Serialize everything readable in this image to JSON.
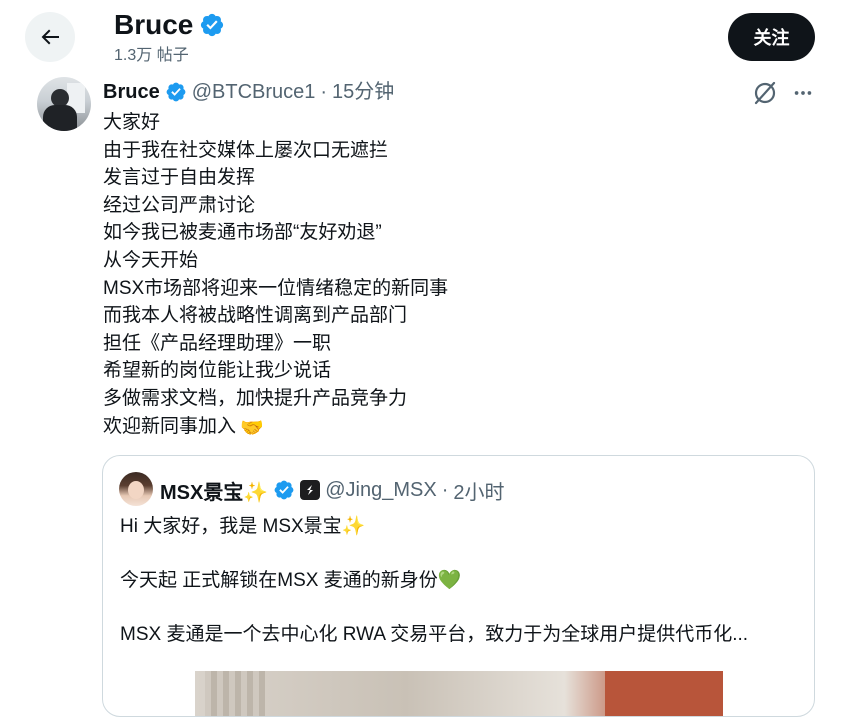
{
  "header": {
    "name": "Bruce",
    "post_count": "1.3万 帖子",
    "follow_label": "关注"
  },
  "tweet": {
    "author_name": "Bruce",
    "handle": "@BTCBruce1",
    "separator": "·",
    "time": "15分钟",
    "lines": [
      "大家好",
      "由于我在社交媒体上屡次口无遮拦",
      "发言过于自由发挥",
      "经过公司严肃讨论",
      "如今我已被麦通市场部“友好劝退”",
      "从今天开始",
      "MSX市场部将迎来一位情绪稳定的新同事",
      "而我本人将被战略性调离到产品部门",
      "担任《产品经理助理》一职",
      "希望新的岗位能让我少说话",
      "多做需求文档，加快提升产品竞争力",
      "欢迎新同事加入"
    ],
    "emoji": "🤝"
  },
  "quote": {
    "author_name": "MSX景宝✨",
    "handle": "@Jing_MSX",
    "separator": "·",
    "time": "2小时",
    "line1": "Hi 大家好，我是 MSX景宝✨",
    "line2": "今天起 正式解锁在MSX 麦通的新身份💚",
    "line3": "MSX 麦通是一个去中心化 RWA 交易平台，致力于为全球用户提供代币化..."
  },
  "icons": {
    "back": "arrow-left-icon",
    "verified": "verified-badge-icon",
    "grok": "grok-icon",
    "more": "more-horizontal-icon",
    "org": "organization-badge-icon"
  },
  "colors": {
    "verified_blue": "#1d9bf0",
    "secondary_text": "#536471",
    "follow_button_bg": "#0f1419"
  }
}
